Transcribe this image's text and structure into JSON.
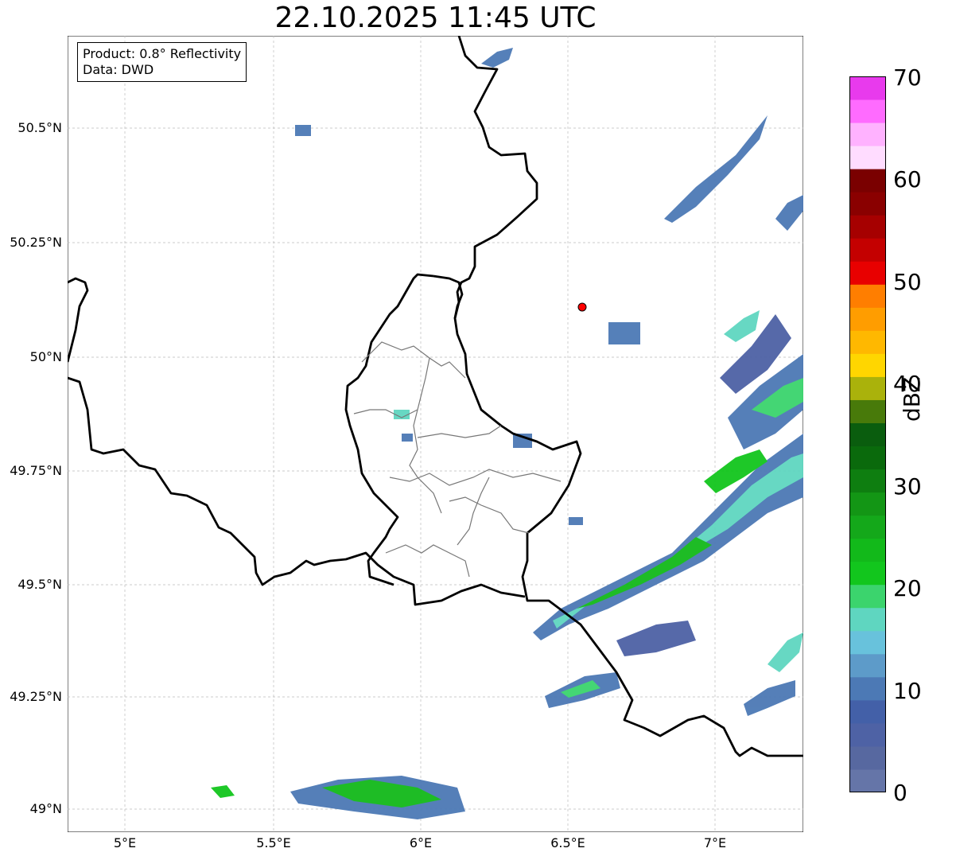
{
  "title": "22.10.2025 11:45 UTC",
  "info": {
    "product": "Product: 0.8° Reflectivity",
    "data": "Data: DWD"
  },
  "axes": {
    "lat_labels": [
      "50.5°N",
      "50.25°N",
      "50°N",
      "49.75°N",
      "49.5°N",
      "49.25°N",
      "49°N"
    ],
    "lon_labels": [
      "5°E",
      "5.5°E",
      "6°E",
      "6.5°E",
      "7°E"
    ]
  },
  "colorbar": {
    "label": "dBZ",
    "ticks": [
      "0",
      "10",
      "20",
      "30",
      "40",
      "50",
      "60",
      "70"
    ],
    "colors": [
      "#6575a8",
      "#5768a0",
      "#4e62a5",
      "#4360a8",
      "#4c79b5",
      "#5d9bc9",
      "#68c2dc",
      "#5fd6c0",
      "#3bd46d",
      "#12c61d",
      "#12b91a",
      "#14a81a",
      "#139615",
      "#0e7e10",
      "#0a6a0c",
      "#0a5d0e",
      "#487a0a",
      "#aab20b",
      "#ffd600",
      "#ffb800",
      "#ff9d00",
      "#ff7e00",
      "#e80000",
      "#c40000",
      "#a60000",
      "#8a0000",
      "#7a0000",
      "#ffdcff",
      "#ffb2ff",
      "#ff6bff",
      "#e83aed"
    ]
  },
  "marker": {
    "name": "site",
    "color": "#ff0000"
  }
}
